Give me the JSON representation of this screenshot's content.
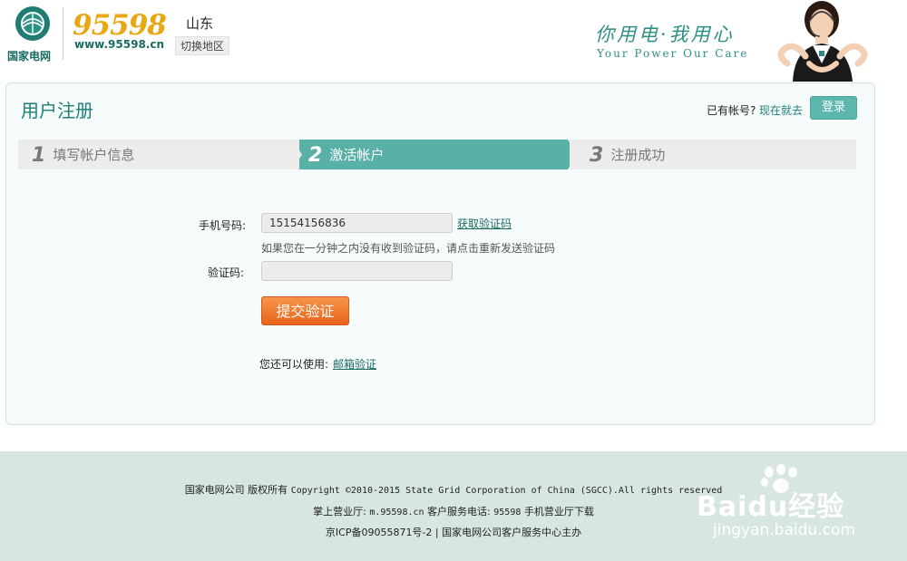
{
  "header": {
    "company_name": "国家电网",
    "brand_number": "95598",
    "brand_url": "www.95598.cn",
    "region": "山东",
    "switch_region_label": "切换地区",
    "slogan_cn": "你用电·我用心",
    "slogan_en": "Your Power  Our Care"
  },
  "panel": {
    "title": "用户注册",
    "have_account_text": "已有帐号?",
    "login_now_link": "现在就去",
    "login_button": "登录"
  },
  "steps": [
    {
      "number": "1",
      "label": "填写帐户信息",
      "state": "done"
    },
    {
      "number": "2",
      "label": "激活帐户",
      "state": "active"
    },
    {
      "number": "3",
      "label": "注册成功",
      "state": "pending"
    }
  ],
  "form": {
    "phone_label": "手机号码:",
    "phone_value": "15154156836",
    "get_code_link": "获取验证码",
    "hint": "如果您在一分钟之内没有收到验证码，请点击重新发送验证码",
    "code_label": "验证码:",
    "code_value": "",
    "submit_button": "提交验证",
    "alt_text": "您还可以使用:",
    "email_verify_link": "邮箱验证"
  },
  "footer": {
    "line1_cn": "国家电网公司  版权所有",
    "line1_en": "Copyright ©2010-2015 State Grid Corporation of China (SGCC).All rights reserved",
    "line2_a": "掌上营业厅:",
    "line2_url": "m.95598.cn",
    "line2_b": "客户服务电话:",
    "line2_phone": "95598",
    "line2_c": "手机营业厅下载",
    "line3": "京ICP备09055871号-2  |  国家电网公司客户服务中心主办"
  },
  "watermark": {
    "brand": "Baidu经验",
    "url": "jingyan.baidu.com"
  },
  "colors": {
    "accent": "#5cb7ad",
    "title": "#1e8177",
    "brand_gold": "#e8a713",
    "submit": "#e8631b",
    "footer_bg": "#d8e6e3"
  }
}
